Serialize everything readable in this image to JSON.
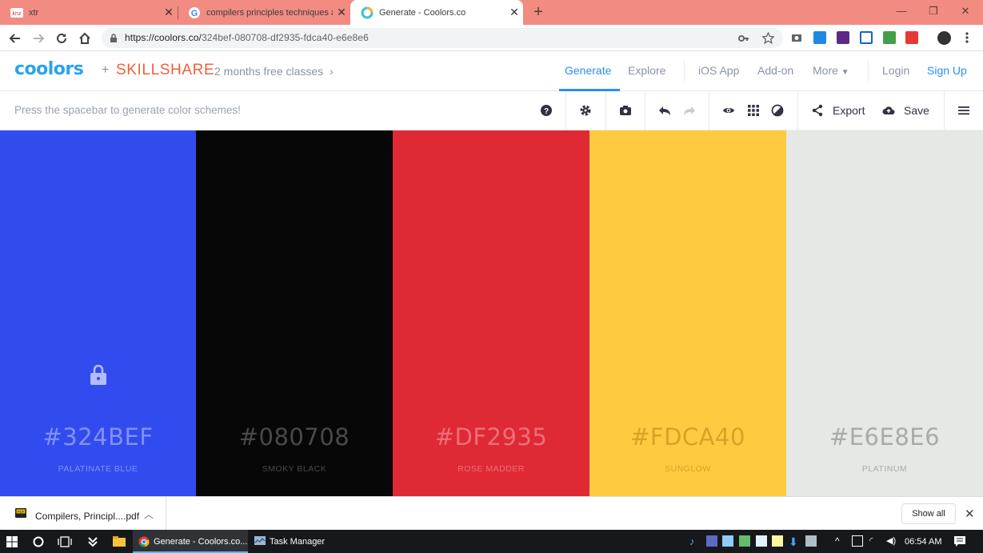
{
  "browser": {
    "tabs": [
      {
        "title": "xtr",
        "favicon": "knz-icon",
        "active": false
      },
      {
        "title": "compilers principles techniques a",
        "favicon": "google-icon",
        "active": false
      },
      {
        "title": "Generate - Coolors.co",
        "favicon": "coolors-icon",
        "active": true
      }
    ],
    "url_host": "https://coolors.co/",
    "url_path": "324bef-080708-df2935-fdca40-e6e8e6"
  },
  "header": {
    "logo": "coolors",
    "plus": "+",
    "partner": "SKILLSHARE",
    "promo": "2 months free classes",
    "nav": {
      "generate": "Generate",
      "explore": "Explore",
      "ios": "iOS App",
      "addon": "Add-on",
      "more": "More",
      "login": "Login",
      "signup": "Sign Up"
    }
  },
  "toolbar": {
    "hint": "Press the spacebar to generate color schemes!",
    "export_label": "Export",
    "save_label": "Save"
  },
  "palette": [
    {
      "hex": "#324BEF",
      "name": "PALATINATE BLUE",
      "color": "#324BEF",
      "text_color": "#8191f5",
      "locked": true
    },
    {
      "hex": "#080708",
      "name": "SMOKY BLACK",
      "color": "#080708",
      "text_color": "#4a494a",
      "locked": false
    },
    {
      "hex": "#DF2935",
      "name": "ROSE MADDER",
      "color": "#DF2935",
      "text_color": "#ec7077",
      "locked": false
    },
    {
      "hex": "#FDCA40",
      "name": "SUNGLOW",
      "color": "#FDCA40",
      "text_color": "#d7a326",
      "locked": false
    },
    {
      "hex": "#E6E8E6",
      "name": "PLATINUM",
      "color": "#E6E8E6",
      "text_color": "#a9aba9",
      "locked": false
    }
  ],
  "downloads": {
    "file_name": "Compilers, Principl....pdf",
    "show_all": "Show all"
  },
  "taskbar": {
    "apps": [
      {
        "label": "Generate - Coolors.co...",
        "icon": "chrome-icon"
      },
      {
        "label": "Task Manager",
        "icon": "task-manager-icon"
      }
    ],
    "clock": "06:54 AM"
  }
}
